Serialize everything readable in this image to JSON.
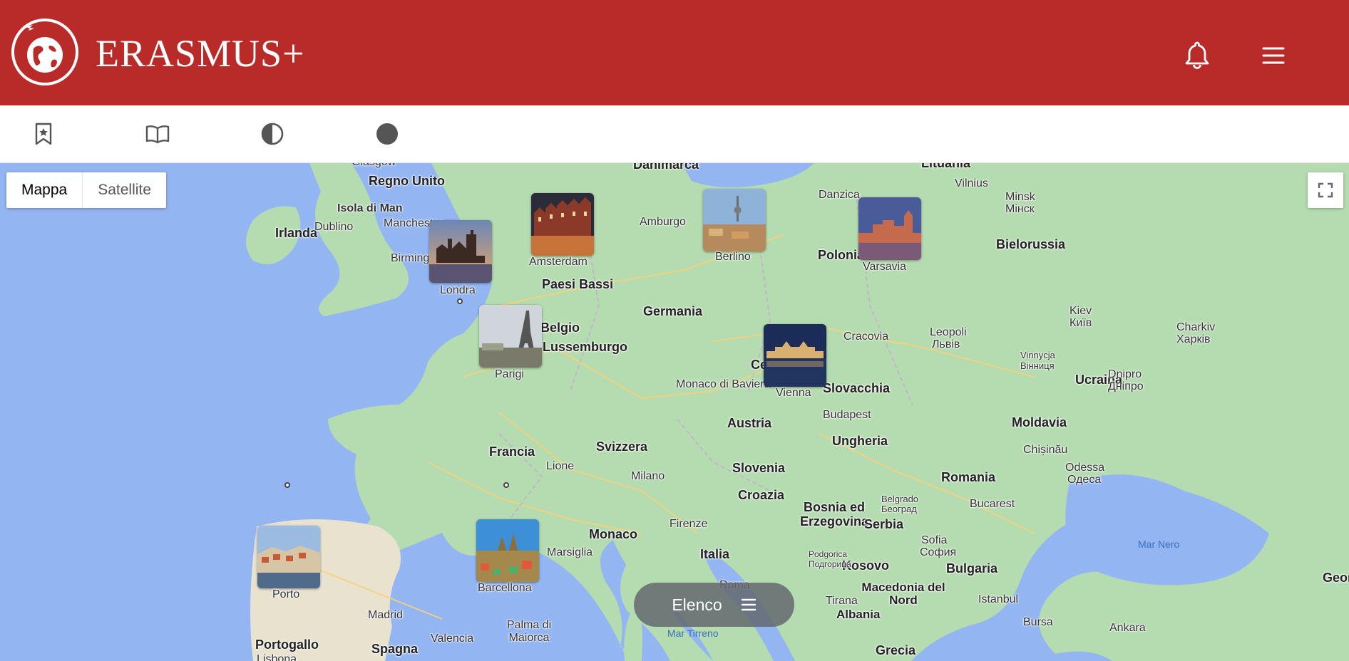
{
  "header": {
    "brand": "ERASMUS+",
    "notifications_icon": "bell-icon",
    "menu_icon": "hamburger-menu-icon",
    "background": "#b92b29"
  },
  "toolbar": {
    "items": [
      {
        "icon": "bookmark-star-icon"
      },
      {
        "icon": "book-open-icon"
      },
      {
        "icon": "contrast-half-circle-icon"
      },
      {
        "icon": "filled-circle-icon"
      }
    ]
  },
  "map": {
    "type_control": {
      "map": "Mappa",
      "satellite": "Satellite",
      "selected": "Mappa"
    },
    "fullscreen_icon": "fullscreen-icon",
    "countries": [
      "Danimarca",
      "Lituania",
      "Regno Unito",
      "Irlanda",
      "Paesi Bassi",
      "Belgio",
      "Lussemburgo",
      "Germania",
      "Polonia",
      "Bielorussia",
      "Ucraina",
      "Slovacchia",
      "Austria",
      "Ungheria",
      "Moldavia",
      "Francia",
      "Svizzera",
      "Slovenia",
      "Croazia",
      "Bosnia ed Erzegovina",
      "Serbia",
      "Romania",
      "Bulgaria",
      "Kosovo",
      "Macedonia del Nord",
      "Albania",
      "Grecia",
      "Italia",
      "Monaco",
      "Portogallo",
      "Spagna",
      "Georgia",
      "Cechia"
    ],
    "cities": [
      "Glasgow",
      "Isola di Man",
      "Dublino",
      "Manchester",
      "Birmingham",
      "Amburgo",
      "Danzica",
      "Vilnius",
      "Minsk",
      "Мінск",
      "Kiev",
      "Київ",
      "Leopoli",
      "Львів",
      "Charkiv",
      "Харків",
      "Vinnycja",
      "Вінниця",
      "Dnipro",
      "Дніпро",
      "Cracovia",
      "Monaco di Baviera",
      "Budapest",
      "Chișinău",
      "Odessa",
      "Одеса",
      "Lione",
      "Milano",
      "Belgrado",
      "Београд",
      "Bucarest",
      "Firenze",
      "Marsiglia",
      "Sofia",
      "София",
      "Podgorica",
      "Подгорица",
      "Roma",
      "Tirana",
      "Istanbul",
      "Bursa",
      "Ankara",
      "Madrid",
      "Valencia",
      "Palma di Maiorca",
      "Lisbona"
    ],
    "seas": [
      "Mar Nero",
      "Mar Tirreno"
    ],
    "destinations": [
      {
        "name": "Londra"
      },
      {
        "name": "Amsterdam"
      },
      {
        "name": "Berlino"
      },
      {
        "name": "Varsavia"
      },
      {
        "name": "Parigi"
      },
      {
        "name": "Vienna"
      },
      {
        "name": "Porto"
      },
      {
        "name": "Barcellona"
      }
    ],
    "list_button": {
      "label": "Elenco",
      "icon": "list-icon"
    }
  }
}
